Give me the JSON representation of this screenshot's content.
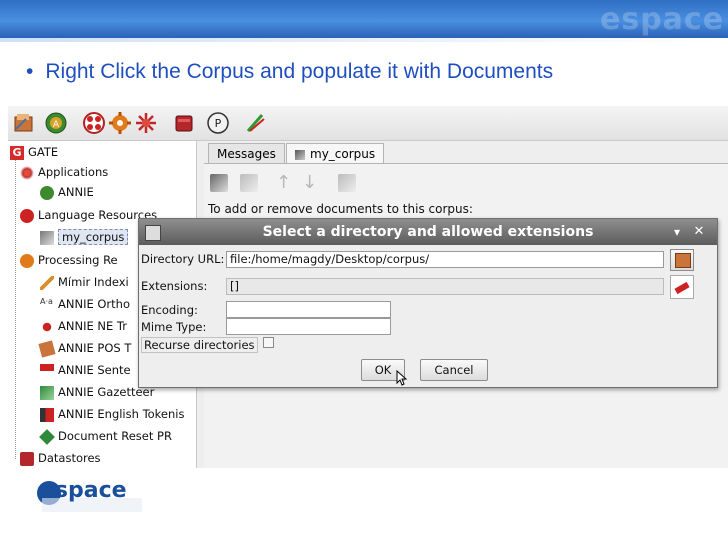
{
  "slide": {
    "bullet_marker": "•",
    "bullet_text": "Right Click the Corpus and populate it with Documents",
    "logo_text": "espace",
    "banner_logo_text": "espace"
  },
  "toolbar": {
    "buttons": [
      "open-icon",
      "annie-icon",
      "lr-icon",
      "pr-icon",
      "cog-icon",
      "datastore-icon",
      "pipeline-icon",
      "edit-icon"
    ]
  },
  "tree": {
    "root": "GATE",
    "applications": "Applications",
    "annie": "ANNIE",
    "language_resources": "Language Resources",
    "my_corpus": "my_corpus",
    "processing_resources": "Processing Re",
    "pr_items": [
      "Mímir Indexi",
      "ANNIE Ortho",
      "ANNIE NE Tr",
      "ANNIE POS T",
      "ANNIE Sente",
      "ANNIE Gazetteer",
      "ANNIE English Tokenis",
      "Document Reset PR"
    ],
    "datastores": "Datastores"
  },
  "tabs": [
    "Messages",
    "my_corpus"
  ],
  "corpus_panel": {
    "message": "To add or remove documents to this corpus:"
  },
  "dialog": {
    "title": "Select a directory and allowed extensions",
    "directory_url_label": "Directory URL:",
    "directory_url_value": "file:/home/magdy/Desktop/corpus/",
    "extensions_label": "Extensions:",
    "extensions_value": "[]",
    "encoding_label": "Encoding:",
    "encoding_value": "",
    "mime_type_label": "Mime Type:",
    "mime_type_value": "",
    "recurse_label": "Recurse directories",
    "recurse_checked": false,
    "ok_label": "OK",
    "cancel_label": "Cancel",
    "minimize_glyph": "▾",
    "close_glyph": "✕"
  }
}
